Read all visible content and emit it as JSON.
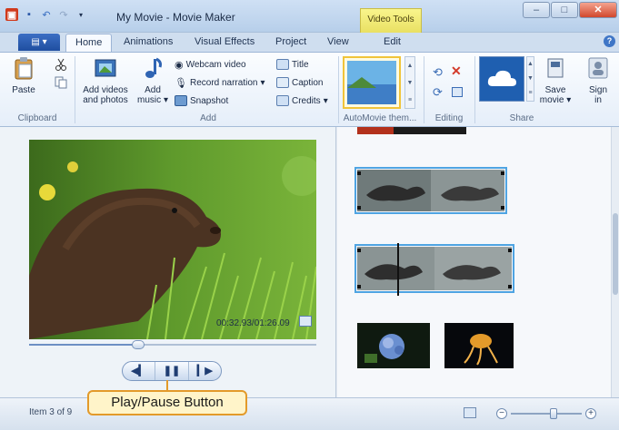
{
  "window": {
    "title": "My Movie - Movie Maker",
    "contextual_tab_group": "Video Tools"
  },
  "tabs": [
    {
      "label": "Home",
      "active": true
    },
    {
      "label": "Animations"
    },
    {
      "label": "Visual Effects"
    },
    {
      "label": "Project"
    },
    {
      "label": "View"
    },
    {
      "label": "Edit"
    }
  ],
  "ribbon": {
    "clipboard": {
      "paste": "Paste",
      "group": "Clipboard"
    },
    "add": {
      "add_videos_line1": "Add videos",
      "add_videos_line2": "and photos",
      "add_music_line1": "Add",
      "add_music_line2": "music",
      "webcam": "Webcam video",
      "narration": "Record narration",
      "snapshot": "Snapshot",
      "title": "Title",
      "caption": "Caption",
      "credits": "Credits",
      "group": "Add"
    },
    "automovie": {
      "group": "AutoMovie them..."
    },
    "editing": {
      "group": "Editing"
    },
    "share": {
      "save_movie_line1": "Save",
      "save_movie_line2": "movie",
      "sign_in_line1": "Sign",
      "sign_in_line2": "in",
      "group": "Share"
    }
  },
  "preview": {
    "timecode": "00:32.93/01:26.09",
    "seek_progress": 0.38,
    "controls": {
      "prev": "◀▎",
      "pause": "❚❚",
      "next": "▎▶"
    }
  },
  "callout": {
    "text": "Play/Pause Button"
  },
  "status": {
    "item_count": "Item 3 of 9",
    "zoom_level": 0.6
  },
  "colors": {
    "accent": "#4fa4e2",
    "callout_border": "#e39a2a",
    "callout_fill": "#fff4c9",
    "video_tools_tab": "#f2ea74"
  }
}
